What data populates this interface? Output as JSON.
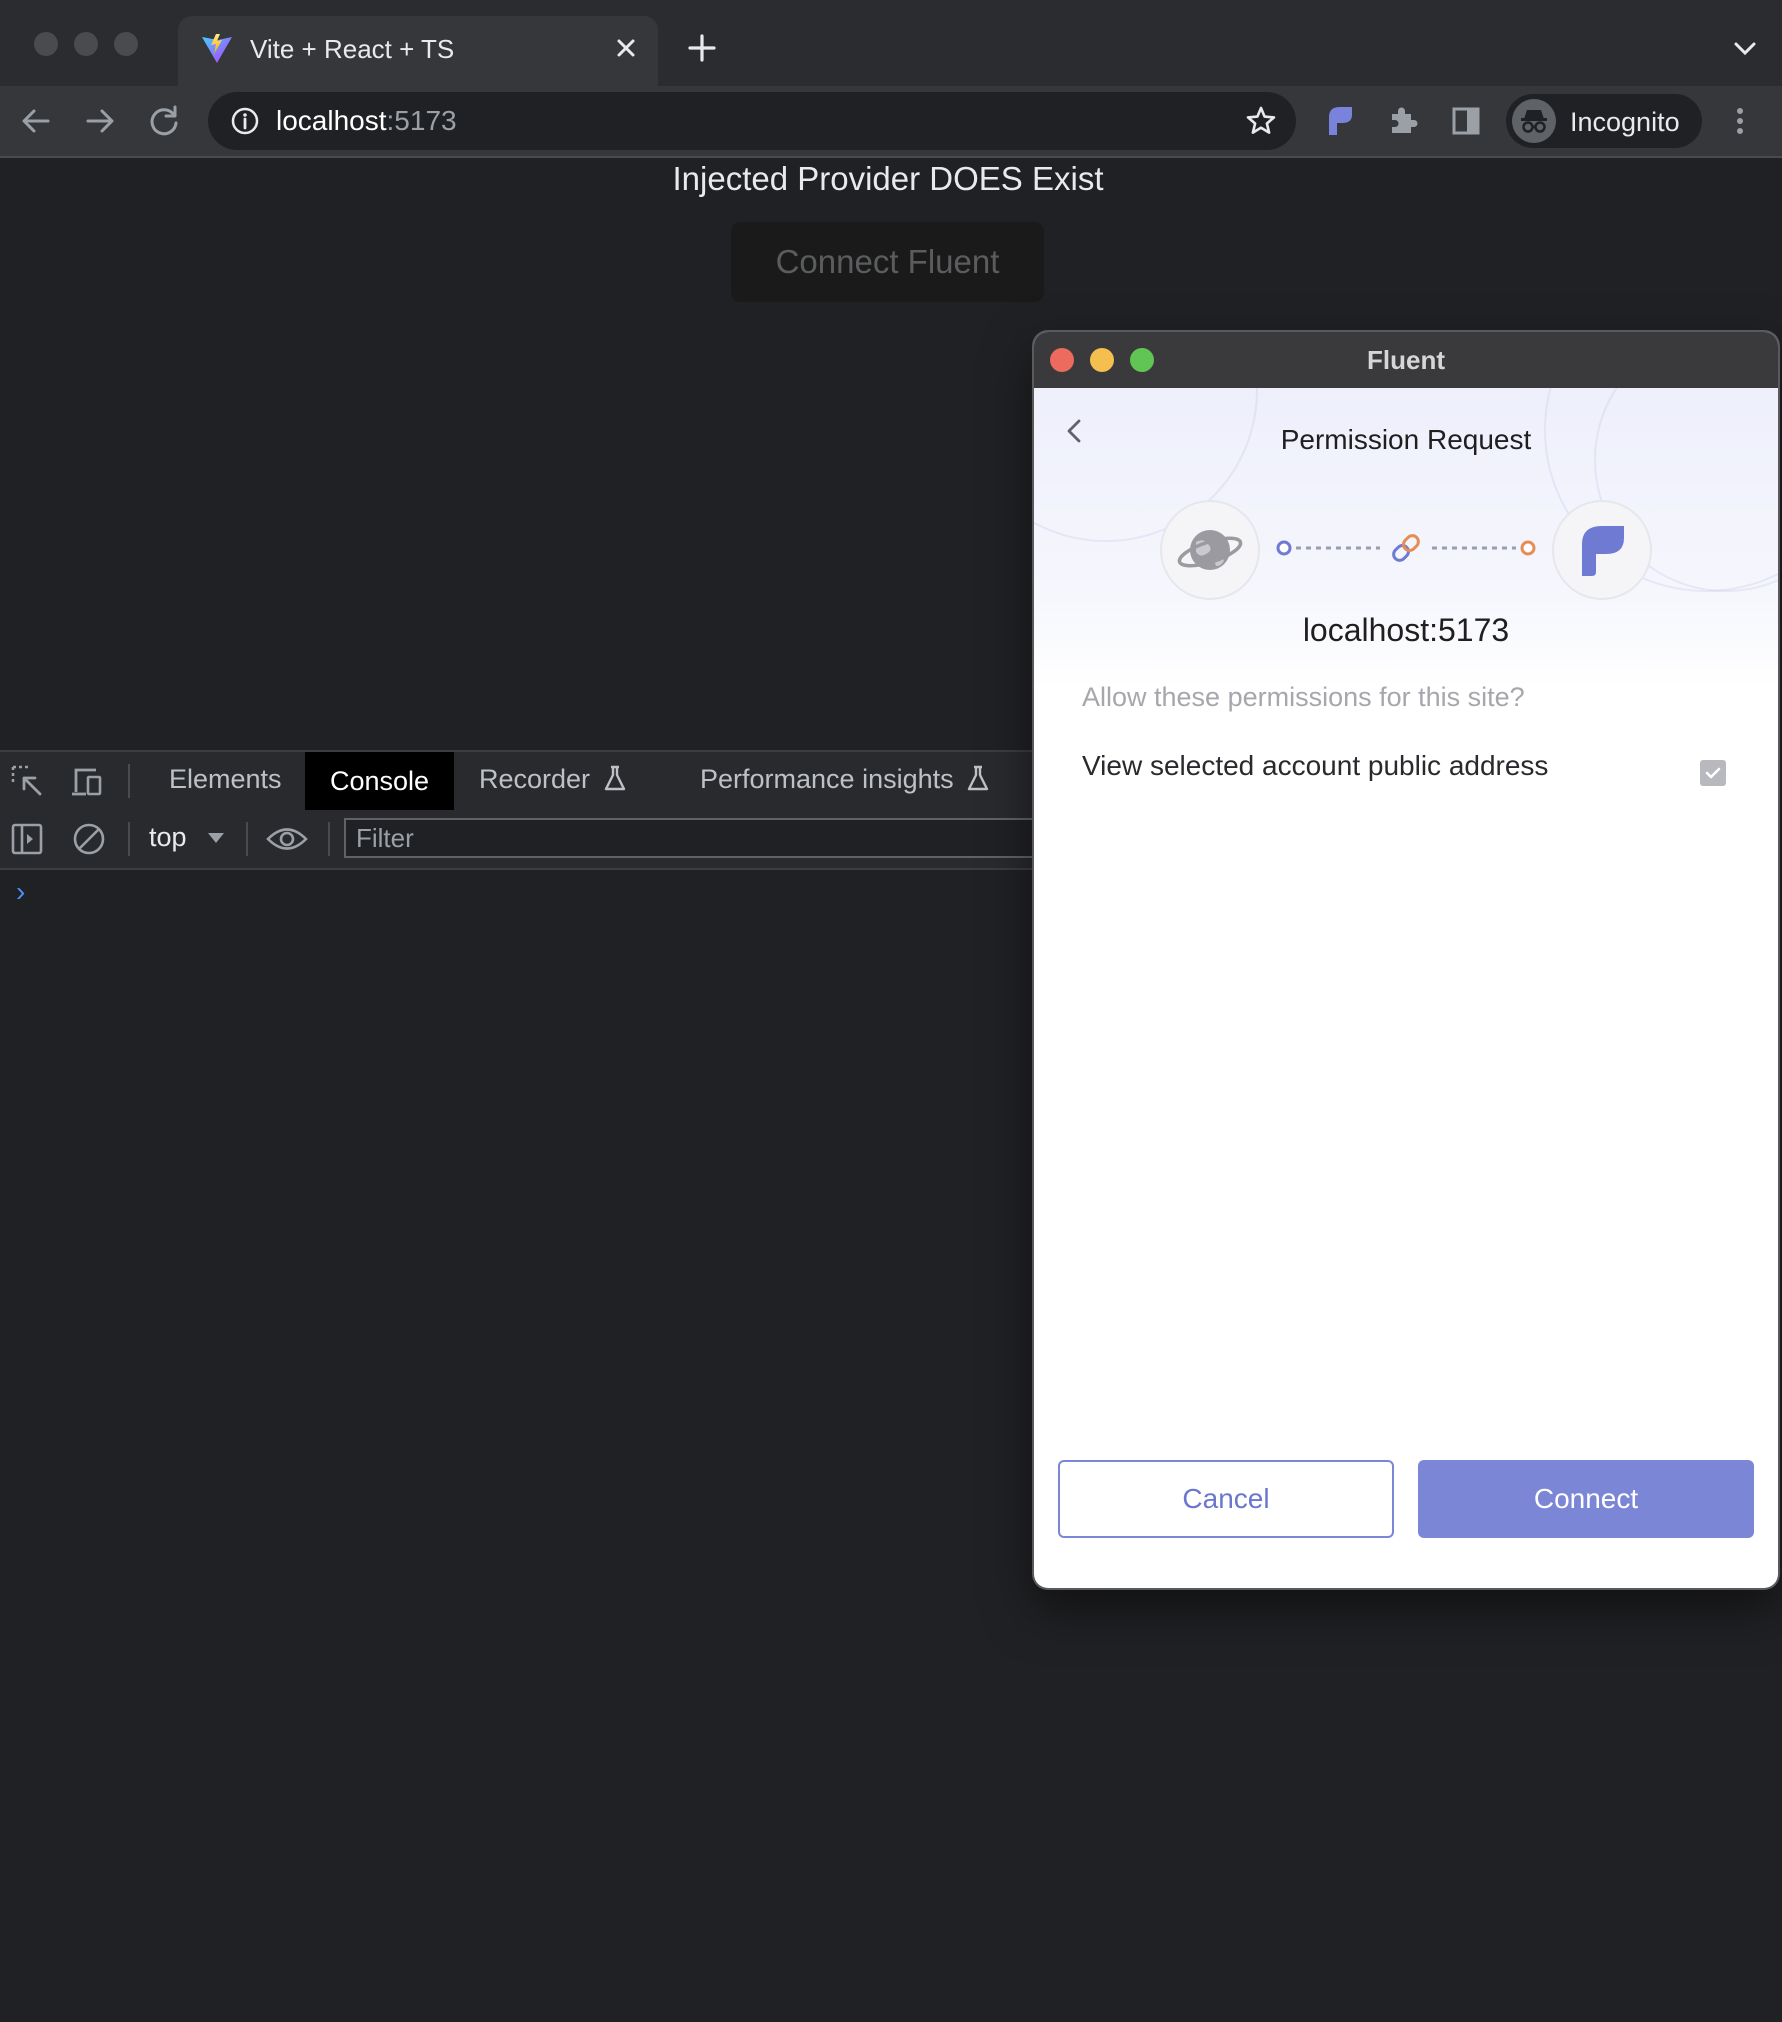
{
  "browser": {
    "tab": {
      "title": "Vite + React + TS"
    },
    "omnibox": {
      "host": "localhost",
      "port": ":5173"
    },
    "profile": {
      "label": "Incognito"
    }
  },
  "page": {
    "heading": "Injected Provider DOES Exist",
    "connect_button": "Connect Fluent"
  },
  "devtools": {
    "tabs": [
      {
        "label": "Elements",
        "active": false
      },
      {
        "label": "Console",
        "active": true
      },
      {
        "label": "Recorder",
        "active": false
      },
      {
        "label": "Performance insights",
        "active": false
      }
    ],
    "console": {
      "context": "top",
      "filter_placeholder": "Filter",
      "prompt": "›"
    }
  },
  "popup": {
    "window_title": "Fluent",
    "title": "Permission Request",
    "site": "localhost:5173",
    "question": "Allow these permissions for this site?",
    "permissions": [
      {
        "label": "View selected account public address",
        "checked": true
      }
    ],
    "cancel_label": "Cancel",
    "connect_label": "Connect",
    "accent_color": "#7c86d6"
  },
  "colors": {
    "traffic_red": "#ed6a5e",
    "traffic_yellow": "#f4bf4f",
    "traffic_green": "#61c554"
  }
}
